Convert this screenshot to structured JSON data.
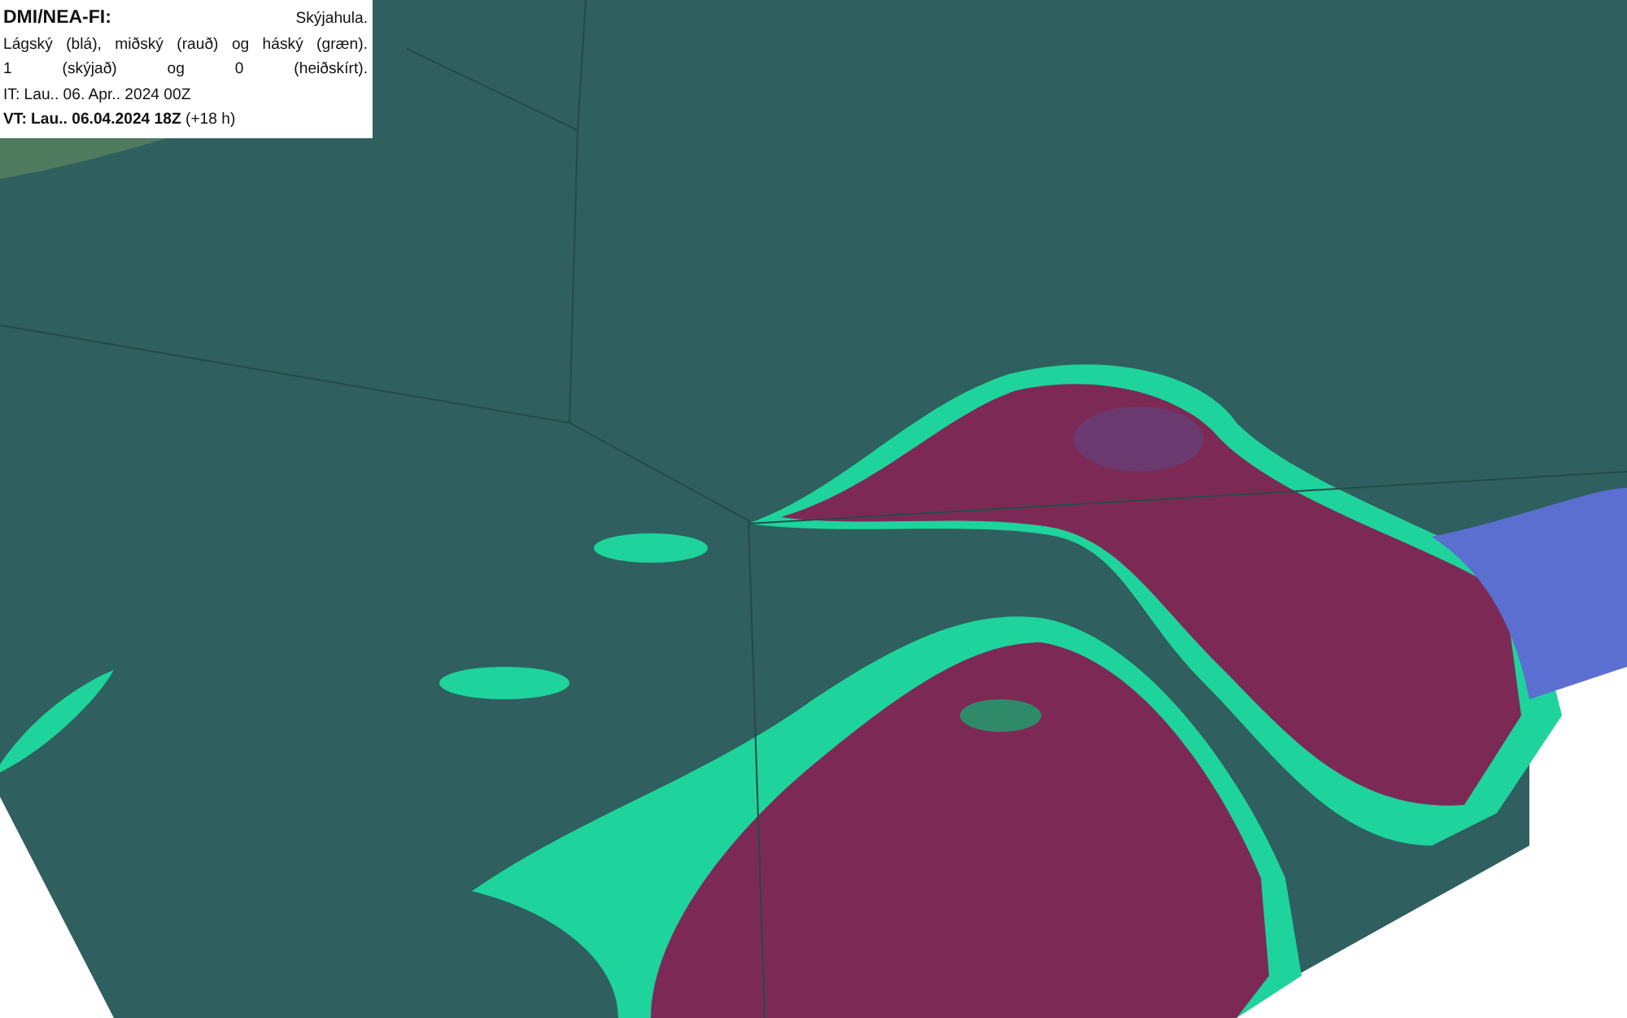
{
  "legend": {
    "source": "DMI/NEA-FI:",
    "product": "Skýjahula.",
    "description_lines": [
      "Lágský (blá), miðský (rauð) og háský (græn).",
      "1 (skýjað) og 0 (heiðskírt)."
    ],
    "initial_time": "IT: Lau.. 06. Apr.. 2024 00Z",
    "valid_time": "**VT: Lau.. 06.04.2024 18Z** (+18 h)"
  }
}
